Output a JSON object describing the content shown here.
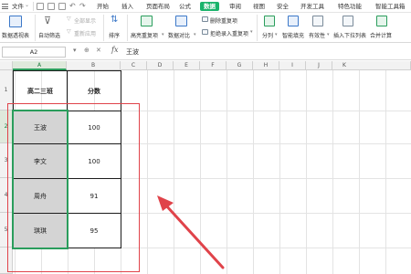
{
  "menubar": {
    "items": [
      "文件",
      "开始",
      "插入",
      "页面布局",
      "公式",
      "数据",
      "审阅",
      "视图",
      "安全",
      "开发工具",
      "特色功能",
      "智能工具箱"
    ],
    "active": "数据"
  },
  "ribbon": {
    "pivot_label": "数据透视表",
    "autofilter_label": "自动筛选",
    "show_all_label": "全部显示",
    "reapply_label": "重新应用",
    "sort_label": "排序",
    "highlight_dup_label": "高亮重复项",
    "data_compare_label": "数据对比",
    "delete_dup_label": "删除重复项",
    "reject_dup_label": "拒绝录入重复项",
    "split_label": "分列",
    "smart_fill_label": "智能填充",
    "validity_label": "有效性",
    "dropdown_label": "插入下拉列表",
    "merge_calc_label": "合并计算"
  },
  "formula_bar": {
    "cell_ref": "A2",
    "fx": "fx",
    "content": "王波"
  },
  "grid": {
    "columns": [
      "A",
      "B",
      "C",
      "D",
      "E",
      "F",
      "G",
      "H",
      "I",
      "J",
      "K"
    ],
    "rows": [
      "1",
      "2",
      "3",
      "4",
      "5"
    ],
    "header_a": "高二三班",
    "header_b": "分数",
    "data": [
      {
        "name": "王波",
        "score": "100"
      },
      {
        "name": "李文",
        "score": "100"
      },
      {
        "name": "周舟",
        "score": "91"
      },
      {
        "name": "琪琪",
        "score": "95"
      }
    ]
  },
  "colors": {
    "accent": "#19b36b",
    "selection": "#2a9d5c",
    "highlight_box": "#e0434a",
    "gray_cell": "#d4d4d4"
  }
}
